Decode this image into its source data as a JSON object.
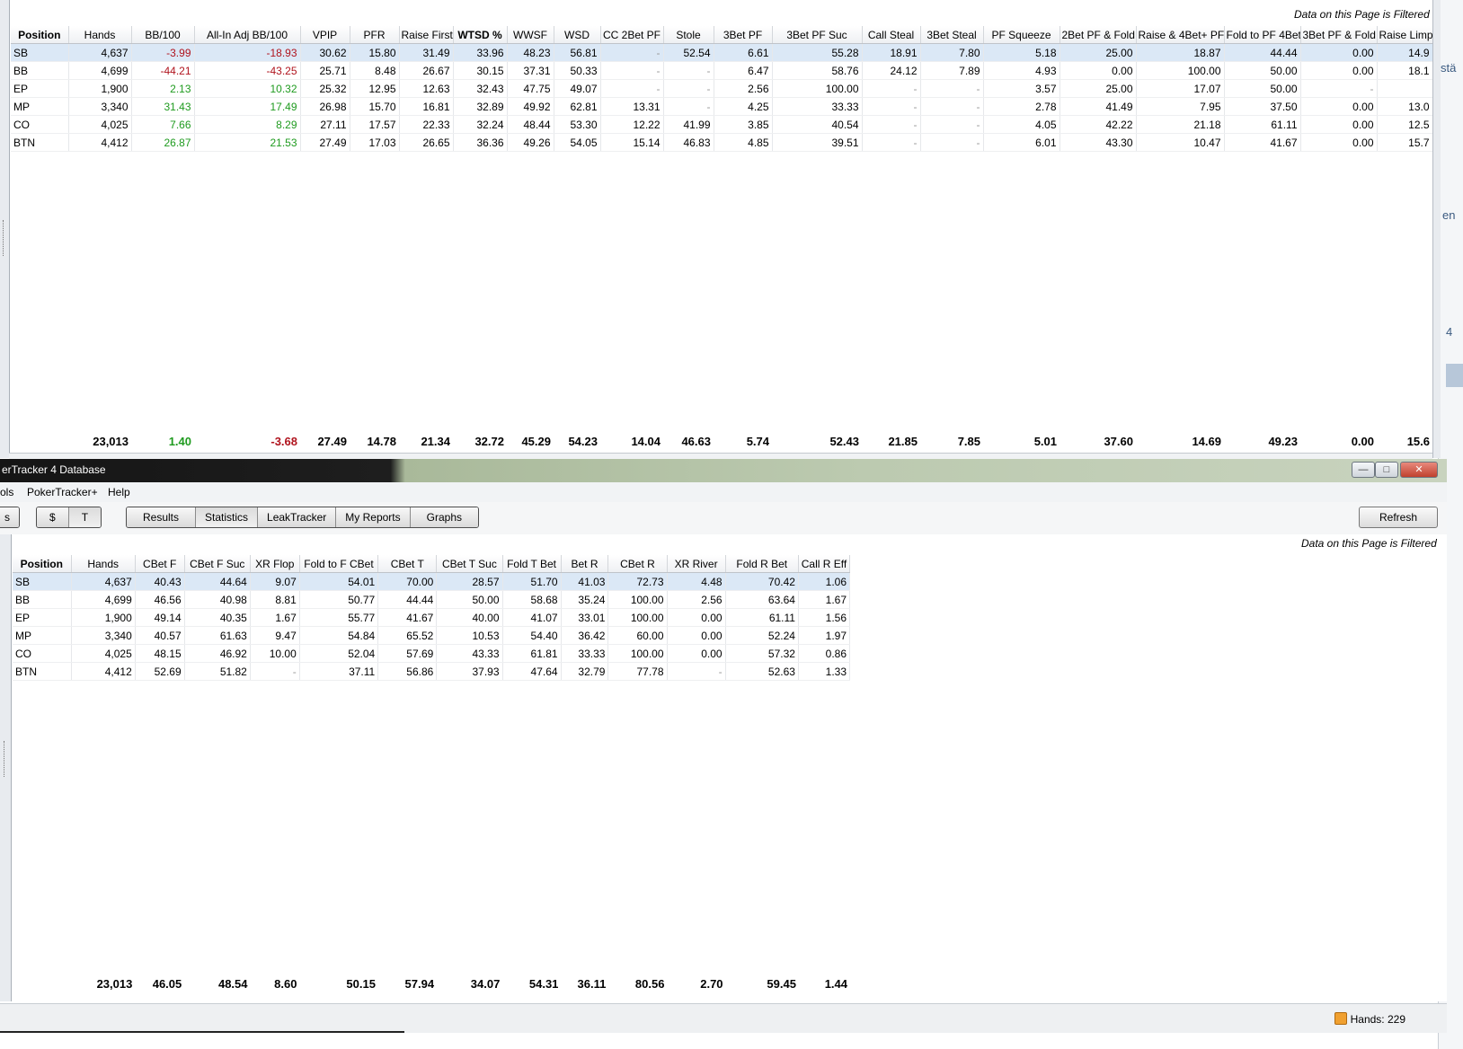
{
  "top": {
    "filtered_note": "Data on this Page is Filtered",
    "columns": [
      "Position",
      "Hands",
      "BB/100",
      "All-In Adj BB/100",
      "VPIP",
      "PFR",
      "Raise First",
      "WTSD %",
      "WWSF",
      "WSD",
      "CC 2Bet PF",
      "Stole",
      "3Bet PF",
      "3Bet PF Suc",
      "Call Steal",
      "3Bet Steal",
      "PF Squeeze",
      "2Bet PF & Fold",
      "Raise & 4Bet+ PF",
      "Fold to PF 4Bet+",
      "3Bet PF & Fold",
      "Raise Limpe"
    ],
    "rows": [
      [
        "SB",
        "4,637",
        "-3.99",
        "-18.93",
        "30.62",
        "15.80",
        "31.49",
        "33.96",
        "48.23",
        "56.81",
        "-",
        "52.54",
        "6.61",
        "55.28",
        "18.91",
        "7.80",
        "5.18",
        "25.00",
        "18.87",
        "44.44",
        "0.00",
        "14.9"
      ],
      [
        "BB",
        "4,699",
        "-44.21",
        "-43.25",
        "25.71",
        "8.48",
        "26.67",
        "30.15",
        "37.31",
        "50.33",
        "-",
        "-",
        "6.47",
        "58.76",
        "24.12",
        "7.89",
        "4.93",
        "0.00",
        "100.00",
        "50.00",
        "0.00",
        "18.1"
      ],
      [
        "EP",
        "1,900",
        "2.13",
        "10.32",
        "25.32",
        "12.95",
        "12.63",
        "32.43",
        "47.75",
        "49.07",
        "-",
        "-",
        "2.56",
        "100.00",
        "-",
        "-",
        "3.57",
        "25.00",
        "17.07",
        "50.00",
        "-",
        ""
      ],
      [
        "MP",
        "3,340",
        "31.43",
        "17.49",
        "26.98",
        "15.70",
        "16.81",
        "32.89",
        "49.92",
        "62.81",
        "13.31",
        "-",
        "4.25",
        "33.33",
        "-",
        "-",
        "2.78",
        "41.49",
        "7.95",
        "37.50",
        "0.00",
        "13.0"
      ],
      [
        "CO",
        "4,025",
        "7.66",
        "8.29",
        "27.11",
        "17.57",
        "22.33",
        "32.24",
        "48.44",
        "53.30",
        "12.22",
        "41.99",
        "3.85",
        "40.54",
        "-",
        "-",
        "4.05",
        "42.22",
        "21.18",
        "61.11",
        "0.00",
        "12.5"
      ],
      [
        "BTN",
        "4,412",
        "26.87",
        "21.53",
        "27.49",
        "17.03",
        "26.65",
        "36.36",
        "49.26",
        "54.05",
        "15.14",
        "46.83",
        "4.85",
        "39.51",
        "-",
        "-",
        "6.01",
        "43.30",
        "10.47",
        "41.67",
        "0.00",
        "15.7"
      ]
    ],
    "totals": [
      "",
      "23,013",
      "1.40",
      "-3.68",
      "27.49",
      "14.78",
      "21.34",
      "32.72",
      "45.29",
      "54.23",
      "14.04",
      "46.63",
      "5.74",
      "52.43",
      "21.85",
      "7.85",
      "5.01",
      "37.60",
      "14.69",
      "49.23",
      "0.00",
      "15.6"
    ]
  },
  "window": {
    "title": "erTracker 4 Database",
    "menu": [
      "ols",
      "PokerTracker+",
      "Help"
    ],
    "toggle": [
      "$",
      "T"
    ],
    "tabs": [
      "Results",
      "Statistics",
      "LeakTracker",
      "My Reports",
      "Graphs"
    ],
    "left_cut": "s",
    "refresh": "Refresh"
  },
  "bottom": {
    "filtered_note": "Data on this Page is Filtered",
    "columns": [
      "Position",
      "Hands",
      "CBet F",
      "CBet F Suc",
      "XR Flop",
      "Fold to F CBet",
      "CBet T",
      "CBet T Suc",
      "Fold T Bet",
      "Bet R",
      "CBet R",
      "XR River",
      "Fold R Bet",
      "Call R Eff"
    ],
    "rows": [
      [
        "SB",
        "4,637",
        "40.43",
        "44.64",
        "9.07",
        "54.01",
        "70.00",
        "28.57",
        "51.70",
        "41.03",
        "72.73",
        "4.48",
        "70.42",
        "1.06"
      ],
      [
        "BB",
        "4,699",
        "46.56",
        "40.98",
        "8.81",
        "50.77",
        "44.44",
        "50.00",
        "58.68",
        "35.24",
        "100.00",
        "2.56",
        "63.64",
        "1.67"
      ],
      [
        "EP",
        "1,900",
        "49.14",
        "40.35",
        "1.67",
        "55.77",
        "41.67",
        "40.00",
        "41.07",
        "33.01",
        "100.00",
        "0.00",
        "61.11",
        "1.56"
      ],
      [
        "MP",
        "3,340",
        "40.57",
        "61.63",
        "9.47",
        "54.84",
        "65.52",
        "10.53",
        "54.40",
        "36.42",
        "60.00",
        "0.00",
        "52.24",
        "1.97"
      ],
      [
        "CO",
        "4,025",
        "48.15",
        "46.92",
        "10.00",
        "52.04",
        "57.69",
        "43.33",
        "61.81",
        "33.33",
        "100.00",
        "0.00",
        "57.32",
        "0.86"
      ],
      [
        "BTN",
        "4,412",
        "52.69",
        "51.82",
        "-",
        "37.11",
        "56.86",
        "37.93",
        "47.64",
        "32.79",
        "77.78",
        "-",
        "52.63",
        "1.33"
      ]
    ],
    "totals": [
      "",
      "23,013",
      "46.05",
      "48.54",
      "8.60",
      "50.15",
      "57.94",
      "34.07",
      "54.31",
      "36.11",
      "80.56",
      "2.70",
      "59.45",
      "1.44"
    ]
  },
  "status": {
    "hands": "Hands: 229"
  },
  "background_window": {
    "fragments": [
      "stä",
      "en",
      "4"
    ]
  },
  "colors": {
    "negative": "#b0141e",
    "positive": "#1f9b1f",
    "selected_row": "#dbe8f6"
  }
}
